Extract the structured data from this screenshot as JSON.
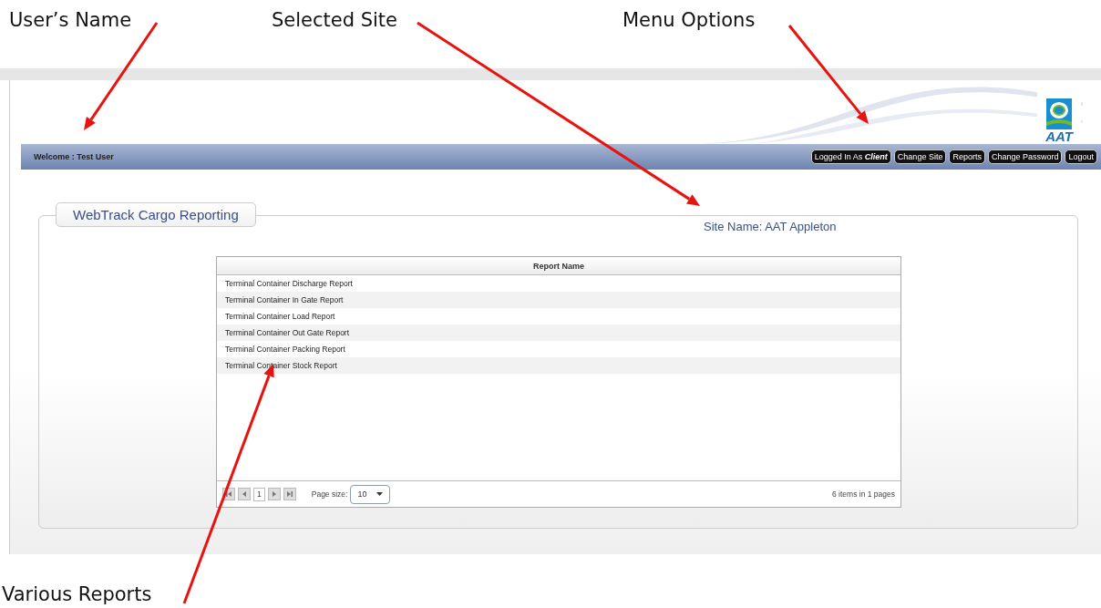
{
  "annotations": [
    {
      "label": "User’s Name"
    },
    {
      "label": "Selected Site"
    },
    {
      "label": "Menu Options"
    },
    {
      "label": "Various Reports"
    }
  ],
  "header": {
    "welcome": "Welcome : Test User",
    "logo_text": "AAT",
    "menu": [
      {
        "kind": "role",
        "prefix": "Logged In As",
        "role": "Client"
      },
      {
        "kind": "link",
        "label": "Change Site"
      },
      {
        "kind": "link",
        "label": "Reports"
      },
      {
        "kind": "link",
        "label": "Change Password"
      },
      {
        "kind": "link",
        "label": "Logout"
      }
    ]
  },
  "panel": {
    "title": "WebTrack Cargo Reporting",
    "site": "Site Name: AAT Appleton"
  },
  "table": {
    "columns": [
      "Report Name"
    ],
    "rows": [
      "Terminal Container Discharge Report",
      "Terminal Container In Gate Report",
      "Terminal Container Load Report",
      "Terminal Container Out Gate Report",
      "Terminal Container Packing Report",
      "Terminal Container Stock Report"
    ],
    "pager": {
      "page": "1",
      "page_size_label": "Page size:",
      "page_size": "10",
      "summary": "6 items in 1 pages"
    }
  }
}
